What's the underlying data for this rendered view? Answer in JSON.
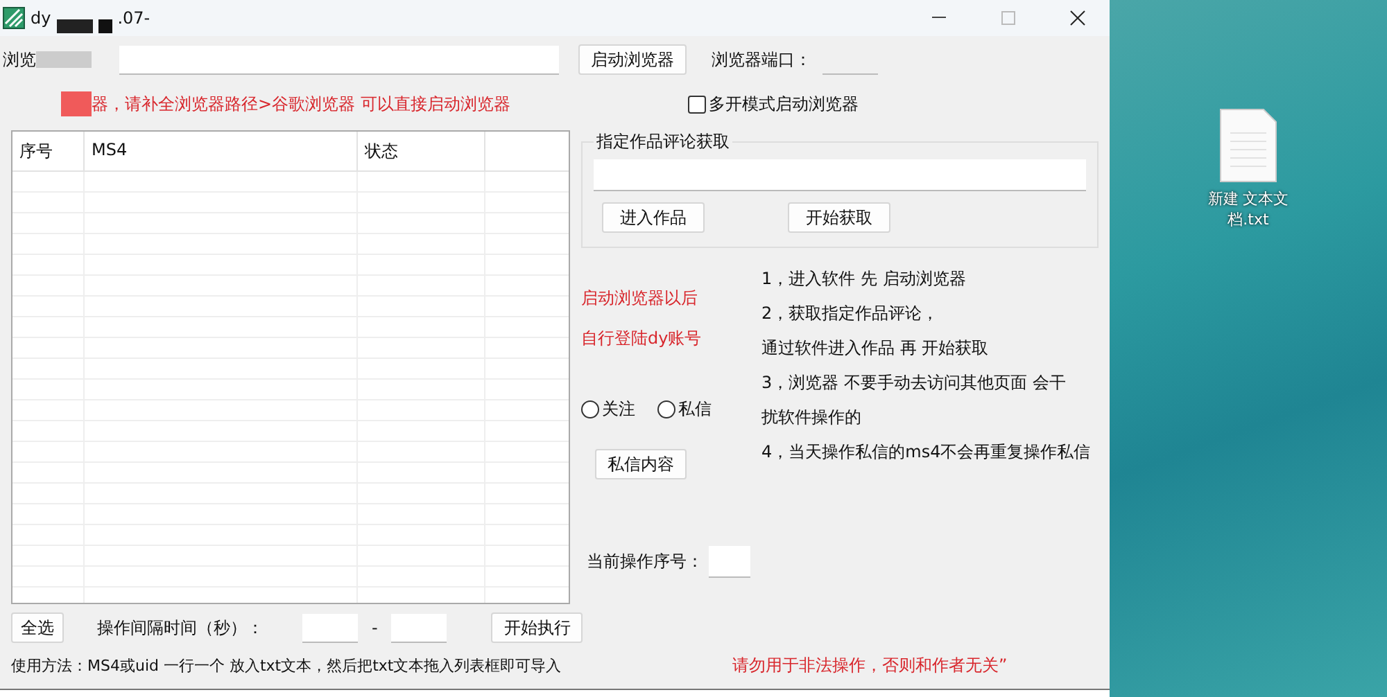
{
  "window": {
    "title": "dy",
    "version": ".07-"
  },
  "browser_row": {
    "label": "浏览",
    "launch_button": "启动浏览器",
    "port_label": "浏览器端口："
  },
  "hint": "器，请补全浏览器路径>谷歌浏览器 可以直接启动浏览器",
  "multi_mode": {
    "label": "多开模式启动浏览器",
    "checked": false
  },
  "table": {
    "columns": [
      "序号",
      "MS4",
      "状态"
    ]
  },
  "comment_group": {
    "title": "指定作品评论获取",
    "buttons": [
      "进入作品",
      "开始获取"
    ]
  },
  "login_notes": [
    "启动浏览器以后",
    "自行登陆dy账号"
  ],
  "radios": [
    {
      "label": "关注",
      "selected": false
    },
    {
      "label": "私信",
      "selected": false
    }
  ],
  "message_button": "私信内容",
  "current_label": "当前操作序号：",
  "instructions": [
    "1，进入软件 先 启动浏览器",
    "2，获取指定作品评论，",
    "通过软件进入作品 再 开始获取",
    "3，浏览器 不要手动去访问其他页面 会干",
    "扰软件操作的",
    "4，当天操作私信的ms4不会再重复操作私信"
  ],
  "bottom_bar": {
    "select_all": "全选",
    "interval_label": "操作间隔时间（秒）：",
    "dash": "-",
    "start": "开始执行"
  },
  "usage": "使用方法：MS4或uid 一行一个 放入txt文本，然后把txt文本拖入列表框即可导入",
  "warning": "请勿用于非法操作，否则和作者无关”",
  "desktop_icon": {
    "label": "新建 文本文档.txt"
  }
}
